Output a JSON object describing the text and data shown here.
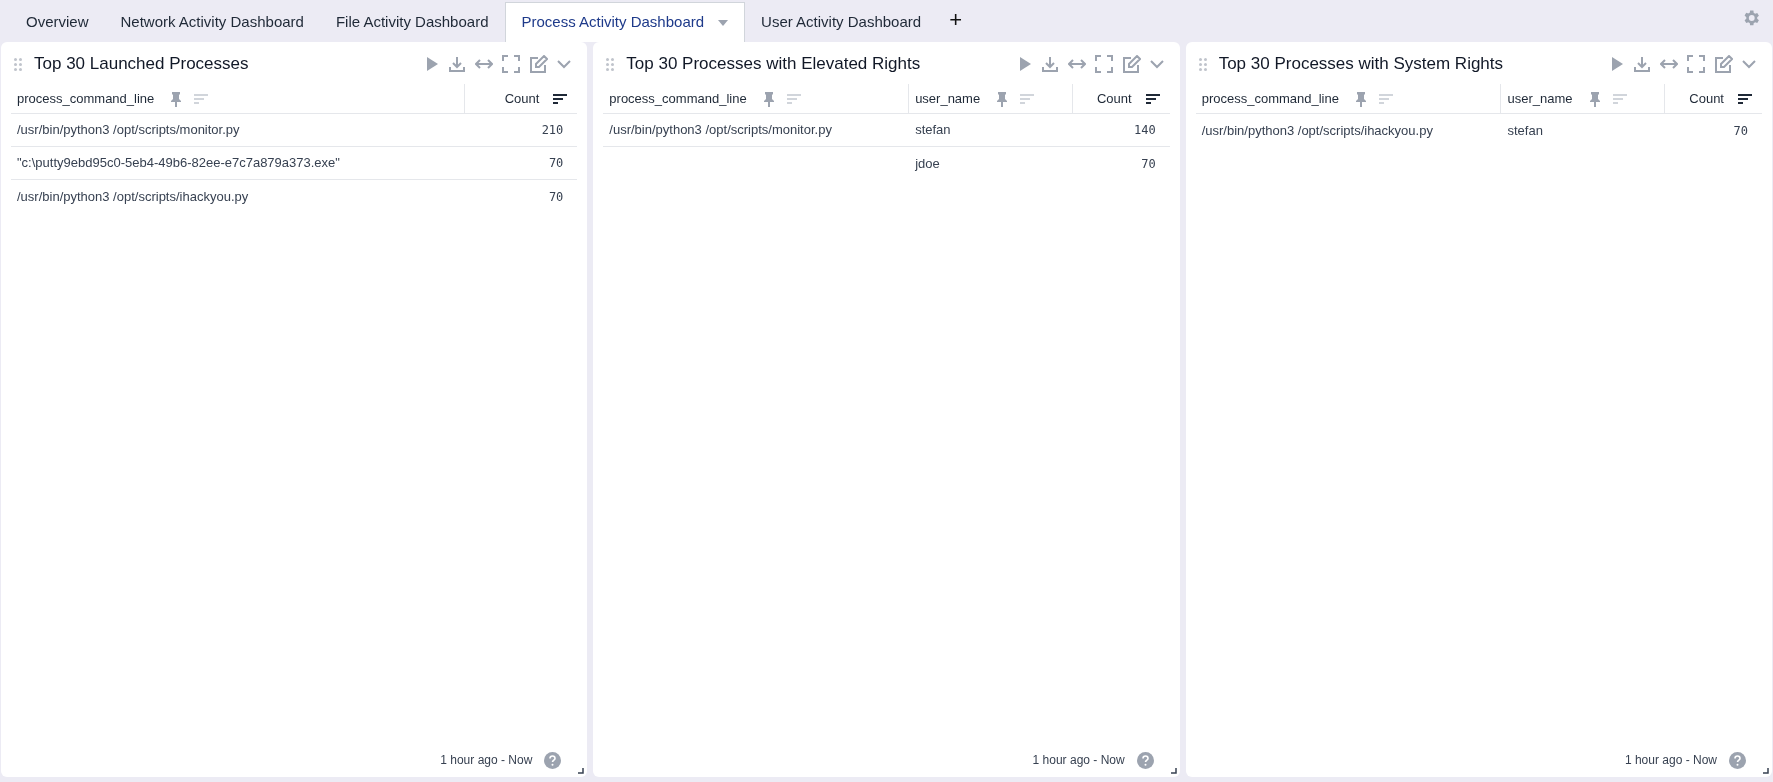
{
  "tabs": [
    {
      "label": "Overview",
      "selected": false
    },
    {
      "label": "Network Activity Dashboard",
      "selected": false
    },
    {
      "label": "File Activity Dashboard",
      "selected": false
    },
    {
      "label": "Process Activity Dashboard",
      "selected": true
    },
    {
      "label": "User Activity Dashboard",
      "selected": false
    }
  ],
  "add_tab": "+",
  "panels": [
    {
      "title": "Top 30 Launched Processes",
      "columns": [
        {
          "label": "process_command_line",
          "kind": "text"
        },
        {
          "label": "Count",
          "kind": "count"
        }
      ],
      "rows": [
        [
          "/usr/bin/python3 /opt/scripts/monitor.py",
          "210"
        ],
        [
          "\"c:\\putty9ebd95c0-5eb4-49b6-82ee-e7c7a879a373.exe\"",
          "70"
        ],
        [
          "/usr/bin/python3 /opt/scripts/ihackyou.py",
          "70"
        ]
      ],
      "footer": "1 hour ago - Now"
    },
    {
      "title": "Top 30 Processes with Elevated Rights",
      "columns": [
        {
          "label": "process_command_line",
          "kind": "text"
        },
        {
          "label": "user_name",
          "kind": "text"
        },
        {
          "label": "Count",
          "kind": "count"
        }
      ],
      "rows": [
        [
          "/usr/bin/python3 /opt/scripts/monitor.py",
          "stefan",
          "140"
        ],
        [
          null,
          "jdoe",
          "70"
        ]
      ],
      "footer": "1 hour ago - Now"
    },
    {
      "title": "Top 30 Processes with System Rights",
      "columns": [
        {
          "label": "process_command_line",
          "kind": "text"
        },
        {
          "label": "user_name",
          "kind": "text"
        },
        {
          "label": "Count",
          "kind": "count"
        }
      ],
      "rows": [
        [
          "/usr/bin/python3 /opt/scripts/ihackyou.py",
          "stefan",
          "70"
        ]
      ],
      "footer": "1 hour ago - Now"
    }
  ]
}
